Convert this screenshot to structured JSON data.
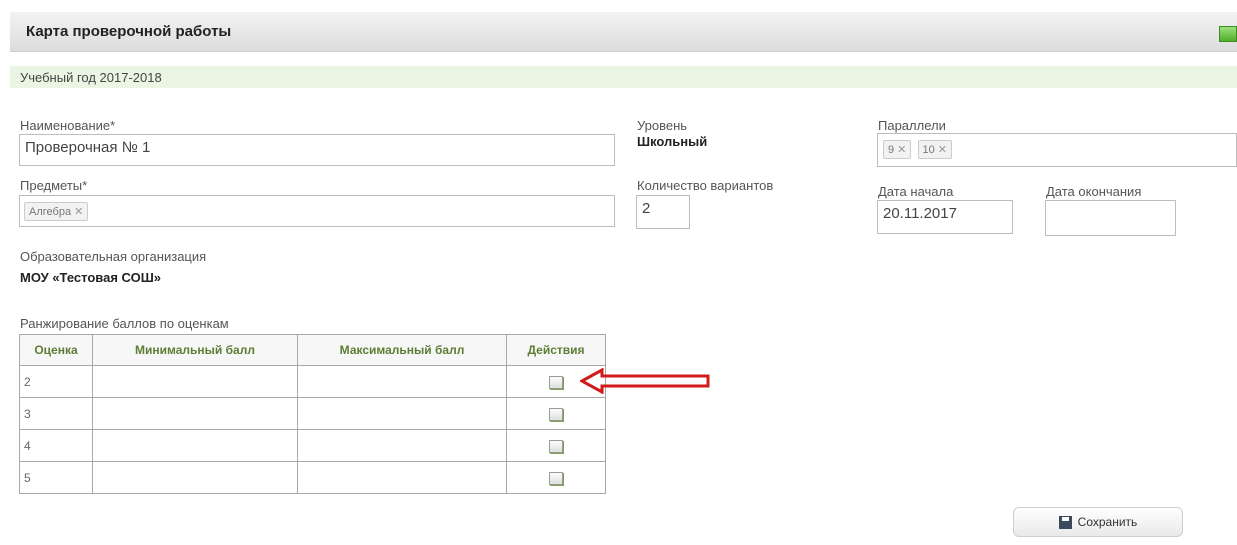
{
  "header": {
    "title": "Карта проверочной работы"
  },
  "year_bar": {
    "text": "Учебный год 2017-2018"
  },
  "form": {
    "name_label": "Наименование*",
    "name_value": "Проверочная № 1",
    "subjects_label": "Предметы*",
    "subjects_tags": [
      "Алгебра"
    ],
    "org_label": "Образовательная организация",
    "org_value": "МОУ «Тестовая СОШ»",
    "level_label": "Уровень",
    "level_value": "Школьный",
    "variants_label": "Количество вариантов",
    "variants_value": "2",
    "parallels_label": "Параллели",
    "parallels_tags": [
      "9",
      "10"
    ],
    "start_date_label": "Дата начала",
    "start_date_value": "20.11.2017",
    "end_date_label": "Дата окончания",
    "end_date_value": ""
  },
  "ranking": {
    "caption": "Ранжирование баллов по оценкам",
    "columns": [
      "Оценка",
      "Минимальный балл",
      "Максимальный балл",
      "Действия"
    ],
    "rows": [
      {
        "grade": "2",
        "min": "",
        "max": ""
      },
      {
        "grade": "3",
        "min": "",
        "max": ""
      },
      {
        "grade": "4",
        "min": "",
        "max": ""
      },
      {
        "grade": "5",
        "min": "",
        "max": ""
      }
    ],
    "action_icon": "edit-icon"
  },
  "annotation": {
    "arrow_color": "#d11a1a"
  },
  "footer": {
    "save_label": "Сохранить"
  },
  "colors": {
    "accent_green": "#5d7d34",
    "year_bar_bg": "#eaf5e3"
  }
}
